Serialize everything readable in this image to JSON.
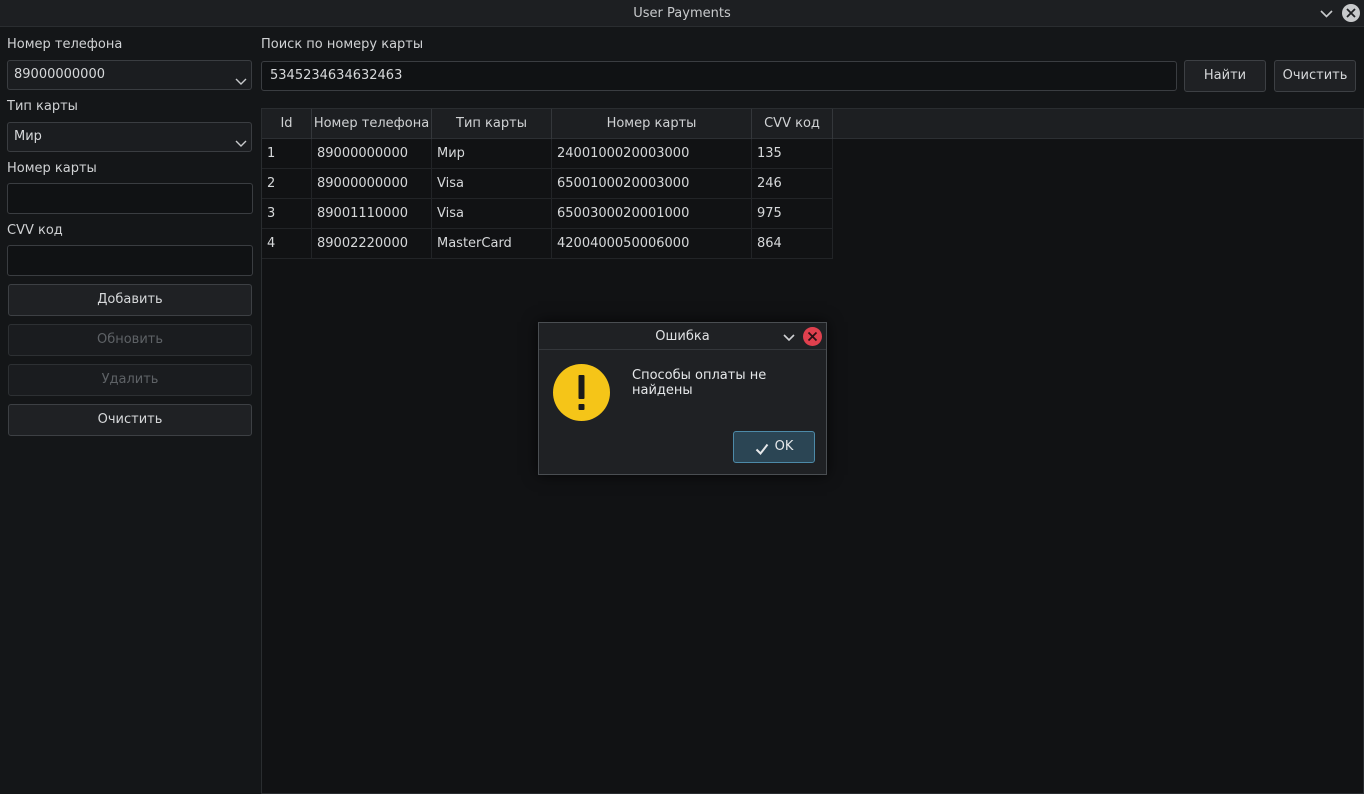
{
  "window": {
    "title": "User Payments"
  },
  "form": {
    "phone_label": "Номер телефона",
    "phone_value": "89000000000",
    "card_type_label": "Тип карты",
    "card_type_value": "Мир",
    "card_number_label": "Номер карты",
    "card_number_value": "",
    "cvv_label": "CVV код",
    "cvv_value": "",
    "add_button": "Добавить",
    "update_button": "Обновить",
    "delete_button": "Удалить",
    "clear_button": "Очистить"
  },
  "search": {
    "label": "Поиск по номеру карты",
    "value": "5345234634632463",
    "find_button": "Найти",
    "clear_button": "Очистить"
  },
  "table": {
    "columns": [
      "Id",
      "Номер телефона",
      "Тип карты",
      "Номер карты",
      "CVV код"
    ],
    "rows": [
      [
        "1",
        "89000000000",
        "Мир",
        "2400100020003000",
        "135"
      ],
      [
        "2",
        "89000000000",
        "Visa",
        "6500100020003000",
        "246"
      ],
      [
        "3",
        "89001110000",
        "Visa",
        "6500300020001000",
        "975"
      ],
      [
        "4",
        "89002220000",
        "MasterCard",
        "4200400050006000",
        "864"
      ]
    ]
  },
  "dialog": {
    "title": "Ошибка",
    "message": "Способы оплаты не найдены",
    "ok_button": "OK",
    "icon": "warning-icon"
  },
  "colors": {
    "background": "#141618",
    "warning": "#f5c518",
    "close_red": "#e0404e",
    "ok_accent": "#4d8aa8"
  }
}
